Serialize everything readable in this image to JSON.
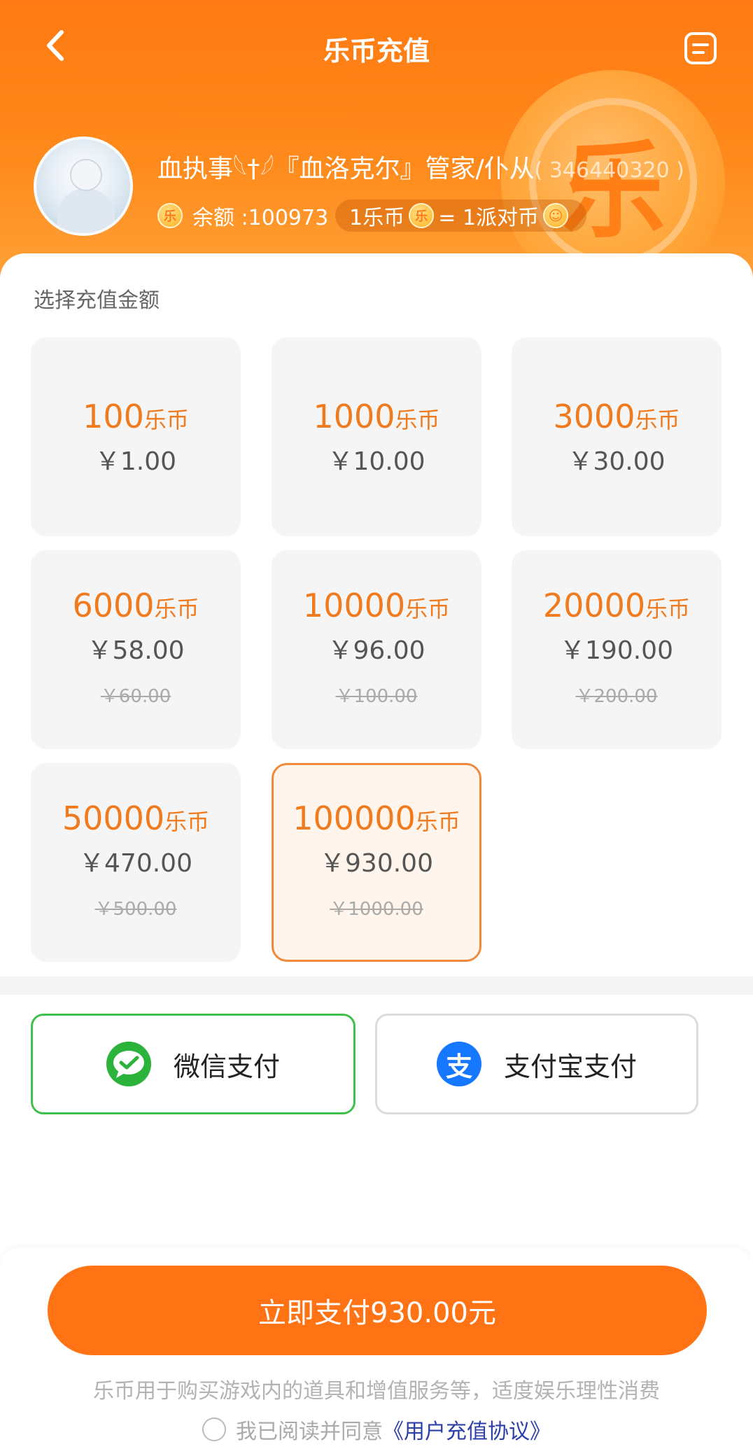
{
  "header": {
    "title": "乐币充值",
    "username": "血执事𓆩†𓆪『血洛克尔』管家/仆从",
    "uid": "( 346440320 )",
    "balance_label": "余额 :100973",
    "rate_left": "1乐币",
    "rate_right": "= 1派对币",
    "coin_icon_char": "乐"
  },
  "main": {
    "section_label": "选择充值金额",
    "unit": "乐币",
    "packages": [
      {
        "amount": "100",
        "price": "￥1.00",
        "original": ""
      },
      {
        "amount": "1000",
        "price": "￥10.00",
        "original": ""
      },
      {
        "amount": "3000",
        "price": "￥30.00",
        "original": ""
      },
      {
        "amount": "6000",
        "price": "￥58.00",
        "original": "￥60.00"
      },
      {
        "amount": "10000",
        "price": "￥96.00",
        "original": "￥100.00"
      },
      {
        "amount": "20000",
        "price": "￥190.00",
        "original": "￥200.00"
      },
      {
        "amount": "50000",
        "price": "￥470.00",
        "original": "￥500.00"
      },
      {
        "amount": "100000",
        "price": "￥930.00",
        "original": "￥1000.00"
      }
    ],
    "selected_index": 7
  },
  "payment": {
    "wechat": "微信支付",
    "alipay": "支付宝支付",
    "alipay_icon_char": "支",
    "selected": "wechat"
  },
  "footer": {
    "pay_button": "立即支付930.00元",
    "notice": "乐币用于购买游戏内的道具和增值服务等，适度娱乐理性消费",
    "agree_text": "我已阅读并同意",
    "agreement_link": "《用户充值协议》"
  },
  "colors": {
    "accent": "#ff7314",
    "amount_text": "#f07a1e",
    "wechat_green": "#3ec04a",
    "alipay_blue": "#1677ff",
    "link_blue": "#2d3fa8"
  }
}
